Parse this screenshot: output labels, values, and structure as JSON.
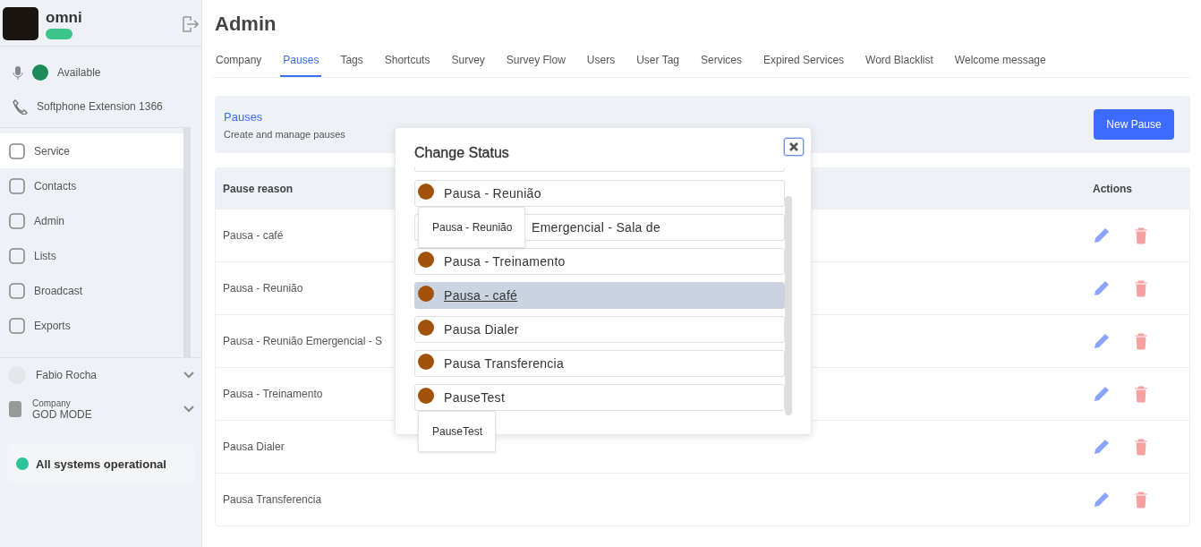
{
  "sidebar": {
    "brand": "omni",
    "status": "Available",
    "softphone": "Softphone Extension 1366",
    "items": [
      {
        "label": "Service",
        "selected": true
      },
      {
        "label": "Contacts",
        "selected": false
      },
      {
        "label": "Admin",
        "selected": false
      },
      {
        "label": "Lists",
        "selected": false
      },
      {
        "label": "Broadcast",
        "selected": false
      },
      {
        "label": "Exports",
        "selected": false
      }
    ],
    "user": "Fabio Rocha",
    "company_label": "Company",
    "company": "GOD MODE",
    "system_status": "All systems operational"
  },
  "page": {
    "title": "Admin",
    "tabs": [
      {
        "label": "Company",
        "selected": false
      },
      {
        "label": "Pauses",
        "selected": true
      },
      {
        "label": "Tags",
        "selected": false
      },
      {
        "label": "Shortcuts",
        "selected": false
      },
      {
        "label": "Survey",
        "selected": false
      },
      {
        "label": "Survey Flow",
        "selected": false
      },
      {
        "label": "Users",
        "selected": false
      },
      {
        "label": "User Tag",
        "selected": false
      },
      {
        "label": "Services",
        "selected": false
      },
      {
        "label": "Expired Services",
        "selected": false
      },
      {
        "label": "Word Blacklist",
        "selected": false
      },
      {
        "label": "Welcome message",
        "selected": false
      }
    ],
    "section": {
      "title": "Pauses",
      "subtitle": "Create and manage pauses",
      "button": "New Pause"
    },
    "table": {
      "columns": [
        "Pause reason",
        "Actions"
      ],
      "rows": [
        "Pausa - café",
        "Pausa - Reunião",
        "Pausa - Reunião Emergencial - S",
        "Pausa - Treinamento",
        "Pausa Dialer",
        "Pausa Transferencia"
      ]
    }
  },
  "modal": {
    "title": "Change Status",
    "items": [
      {
        "kind": "cut"
      },
      {
        "kind": "entry",
        "label": "Pausa - Reunião",
        "color": "#a0520a",
        "selected": false,
        "tooltip": "Pausa - Reunião"
      },
      {
        "kind": "covered",
        "label": "Emergencial - Sala de",
        "selected": false
      },
      {
        "kind": "entry",
        "label": "Pausa - Treinamento",
        "color": "#a0520a",
        "selected": false
      },
      {
        "kind": "entry",
        "label": "Pausa - café",
        "color": "#a0520a",
        "selected": true
      },
      {
        "kind": "entry",
        "label": "Pausa Dialer",
        "color": "#a0520a",
        "selected": false
      },
      {
        "kind": "entry",
        "label": "Pausa Transferencia",
        "color": "#a0520a",
        "selected": false
      },
      {
        "kind": "entry",
        "label": "PauseTest",
        "color": "#a0520a",
        "selected": false,
        "tooltip": "PauseTest"
      }
    ]
  }
}
